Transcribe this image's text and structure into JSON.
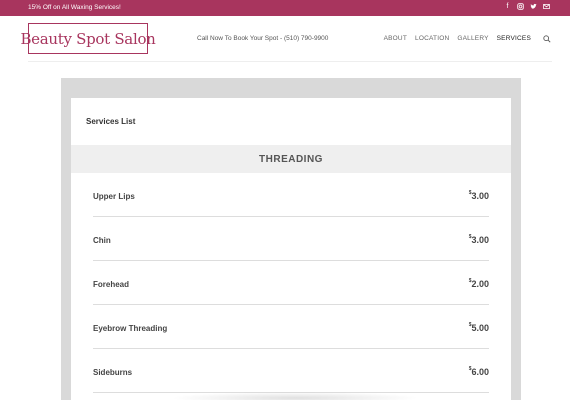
{
  "topbar": {
    "promo": "15% Off on All Waxing Services!",
    "social": [
      "facebook-icon",
      "instagram-icon",
      "twitter-icon",
      "mail-icon"
    ],
    "color": "#a8355e"
  },
  "header": {
    "logo": "Beauty Spot Salon",
    "call": "Call Now To Book Your Spot - (510) 790-9900",
    "nav": [
      "ABOUT",
      "LOCATION",
      "GALLERY",
      "SERVICES"
    ],
    "active_nav": "SERVICES"
  },
  "services": {
    "title": "Services List",
    "category": "THREADING",
    "currency": "$",
    "items": [
      {
        "name": "Upper Lips",
        "price": "3.00"
      },
      {
        "name": "Chin",
        "price": "3.00"
      },
      {
        "name": "Forehead",
        "price": "2.00"
      },
      {
        "name": "Eyebrow Threading",
        "price": "5.00"
      },
      {
        "name": "Sideburns",
        "price": "6.00"
      }
    ]
  }
}
